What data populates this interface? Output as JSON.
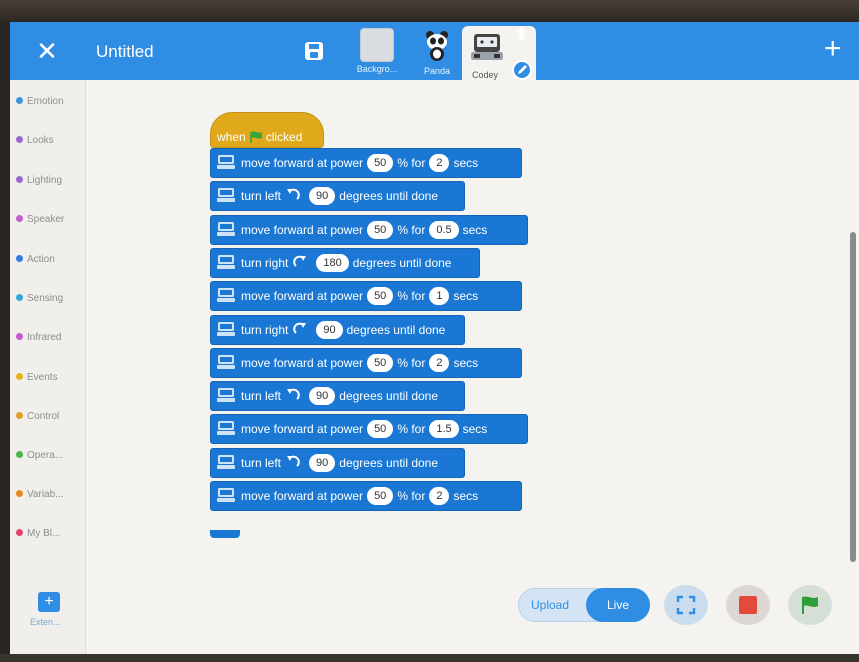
{
  "topbar": {
    "close_glyph": "✕",
    "project_title": "Untitled",
    "add_glyph": "+",
    "sprites": [
      {
        "label": "Backgro..."
      },
      {
        "label": "Panda"
      },
      {
        "label": "Codey"
      }
    ]
  },
  "sidebar": {
    "categories": [
      {
        "label": "Emotion",
        "color": "#3d97e0"
      },
      {
        "label": "Looks",
        "color": "#9a67d4"
      },
      {
        "label": "Lighting",
        "color": "#9a67d4"
      },
      {
        "label": "Speaker",
        "color": "#c45bd0"
      },
      {
        "label": "Action",
        "color": "#2f7fe0"
      },
      {
        "label": "Sensing",
        "color": "#34a7d6"
      },
      {
        "label": "Infrared",
        "color": "#c45bd0"
      },
      {
        "label": "Events",
        "color": "#e3b21d"
      },
      {
        "label": "Control",
        "color": "#e0a023"
      },
      {
        "label": "Opera...",
        "color": "#4cb44c"
      },
      {
        "label": "Variab...",
        "color": "#e58a1f"
      },
      {
        "label": "My Bl...",
        "color": "#e2456b"
      }
    ],
    "extension_glyph": "+",
    "extension_label": "Exten..."
  },
  "script": {
    "hat": {
      "when": "when",
      "clicked": "clicked"
    },
    "blocks": [
      {
        "type": "move",
        "text1": "move forward at power",
        "power": "50",
        "text2": "% for",
        "secs": "2",
        "text3": "secs"
      },
      {
        "type": "turn",
        "text1": "turn left",
        "dir": "left",
        "degrees": "90",
        "text2": "degrees until done"
      },
      {
        "type": "move",
        "text1": "move forward at power",
        "power": "50",
        "text2": "% for",
        "secs": "0.5",
        "text3": "secs"
      },
      {
        "type": "turn",
        "text1": "turn right",
        "dir": "right",
        "degrees": "180",
        "text2": "degrees until done"
      },
      {
        "type": "move",
        "text1": "move forward at power",
        "power": "50",
        "text2": "% for",
        "secs": "1",
        "text3": "secs"
      },
      {
        "type": "turn",
        "text1": "turn right",
        "dir": "right",
        "degrees": "90",
        "text2": "degrees until done"
      },
      {
        "type": "move",
        "text1": "move forward at power",
        "power": "50",
        "text2": "% for",
        "secs": "2",
        "text3": "secs"
      },
      {
        "type": "turn",
        "text1": "turn left",
        "dir": "left",
        "degrees": "90",
        "text2": "degrees until done"
      },
      {
        "type": "move",
        "text1": "move forward at power",
        "power": "50",
        "text2": "% for",
        "secs": "1.5",
        "text3": "secs"
      },
      {
        "type": "turn",
        "text1": "turn left",
        "dir": "left",
        "degrees": "90",
        "text2": "degrees until done"
      },
      {
        "type": "move",
        "text1": "move forward at power",
        "power": "50",
        "text2": "% for",
        "secs": "2",
        "text3": "secs"
      }
    ]
  },
  "controls": {
    "upload_label": "Upload",
    "live_label": "Live"
  },
  "colors": {
    "accent": "#2f8de4",
    "motion_block": "#1a78d4",
    "event_block": "#e0a91c",
    "stop": "#e24a3b",
    "go": "#2f9e3a"
  }
}
